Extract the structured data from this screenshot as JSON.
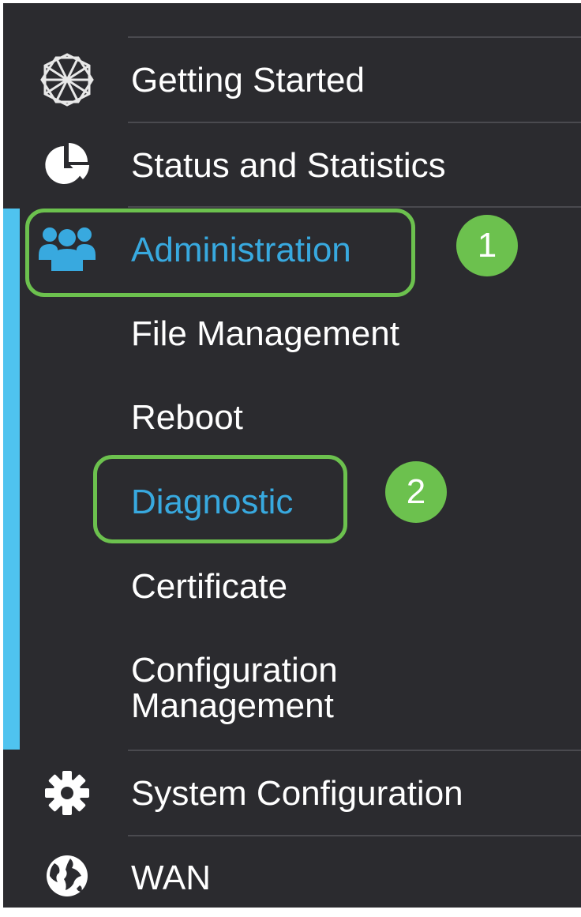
{
  "nav": {
    "getting_started": {
      "label": "Getting Started",
      "icon": "getting-started-icon"
    },
    "status_statistics": {
      "label": "Status and Statistics",
      "icon": "pie-chart-icon"
    },
    "administration": {
      "label": "Administration",
      "icon": "users-icon",
      "active": true,
      "subitems": {
        "file_management": "File Management",
        "reboot": "Reboot",
        "diagnostic": "Diagnostic",
        "certificate": "Certificate",
        "configuration_management_line1": "Configuration",
        "configuration_management_line2": "Management"
      }
    },
    "system_configuration": {
      "label": "System Configuration",
      "icon": "gear-icon"
    },
    "wan": {
      "label": "WAN",
      "icon": "globe-icon"
    }
  },
  "annotations": {
    "step1": "1",
    "step2": "2"
  },
  "colors": {
    "sidebar_bg": "#2b2b2f",
    "active_text": "#38a9df",
    "active_bar": "#4fc3ef",
    "highlight": "#6cc14e",
    "text": "#ffffff"
  }
}
